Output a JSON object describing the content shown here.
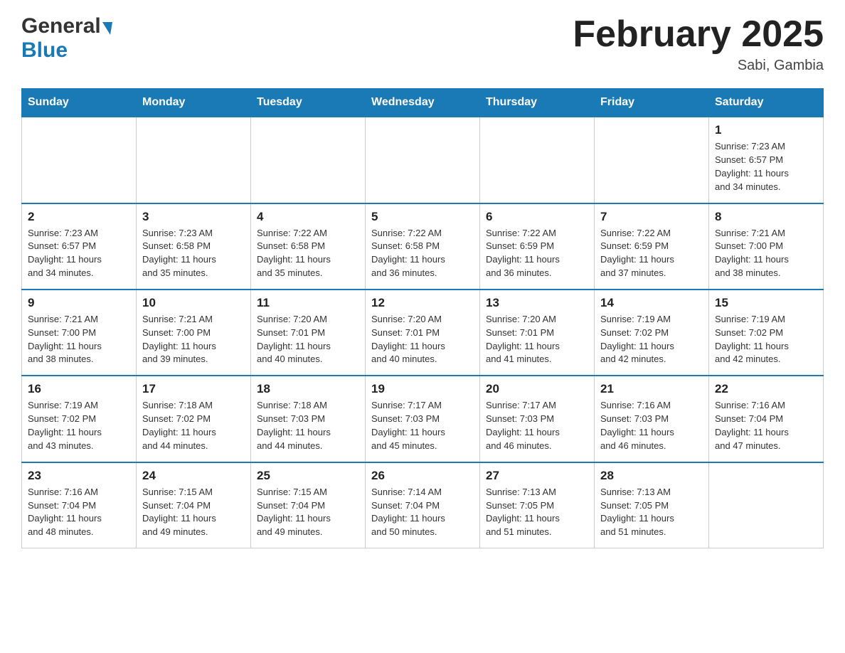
{
  "logo": {
    "general": "General",
    "blue": "Blue"
  },
  "title": {
    "month_year": "February 2025",
    "location": "Sabi, Gambia"
  },
  "days_of_week": [
    "Sunday",
    "Monday",
    "Tuesday",
    "Wednesday",
    "Thursday",
    "Friday",
    "Saturday"
  ],
  "weeks": [
    {
      "cells": [
        {
          "day": "",
          "info": ""
        },
        {
          "day": "",
          "info": ""
        },
        {
          "day": "",
          "info": ""
        },
        {
          "day": "",
          "info": ""
        },
        {
          "day": "",
          "info": ""
        },
        {
          "day": "",
          "info": ""
        },
        {
          "day": "1",
          "info": "Sunrise: 7:23 AM\nSunset: 6:57 PM\nDaylight: 11 hours\nand 34 minutes."
        }
      ]
    },
    {
      "cells": [
        {
          "day": "2",
          "info": "Sunrise: 7:23 AM\nSunset: 6:57 PM\nDaylight: 11 hours\nand 34 minutes."
        },
        {
          "day": "3",
          "info": "Sunrise: 7:23 AM\nSunset: 6:58 PM\nDaylight: 11 hours\nand 35 minutes."
        },
        {
          "day": "4",
          "info": "Sunrise: 7:22 AM\nSunset: 6:58 PM\nDaylight: 11 hours\nand 35 minutes."
        },
        {
          "day": "5",
          "info": "Sunrise: 7:22 AM\nSunset: 6:58 PM\nDaylight: 11 hours\nand 36 minutes."
        },
        {
          "day": "6",
          "info": "Sunrise: 7:22 AM\nSunset: 6:59 PM\nDaylight: 11 hours\nand 36 minutes."
        },
        {
          "day": "7",
          "info": "Sunrise: 7:22 AM\nSunset: 6:59 PM\nDaylight: 11 hours\nand 37 minutes."
        },
        {
          "day": "8",
          "info": "Sunrise: 7:21 AM\nSunset: 7:00 PM\nDaylight: 11 hours\nand 38 minutes."
        }
      ]
    },
    {
      "cells": [
        {
          "day": "9",
          "info": "Sunrise: 7:21 AM\nSunset: 7:00 PM\nDaylight: 11 hours\nand 38 minutes."
        },
        {
          "day": "10",
          "info": "Sunrise: 7:21 AM\nSunset: 7:00 PM\nDaylight: 11 hours\nand 39 minutes."
        },
        {
          "day": "11",
          "info": "Sunrise: 7:20 AM\nSunset: 7:01 PM\nDaylight: 11 hours\nand 40 minutes."
        },
        {
          "day": "12",
          "info": "Sunrise: 7:20 AM\nSunset: 7:01 PM\nDaylight: 11 hours\nand 40 minutes."
        },
        {
          "day": "13",
          "info": "Sunrise: 7:20 AM\nSunset: 7:01 PM\nDaylight: 11 hours\nand 41 minutes."
        },
        {
          "day": "14",
          "info": "Sunrise: 7:19 AM\nSunset: 7:02 PM\nDaylight: 11 hours\nand 42 minutes."
        },
        {
          "day": "15",
          "info": "Sunrise: 7:19 AM\nSunset: 7:02 PM\nDaylight: 11 hours\nand 42 minutes."
        }
      ]
    },
    {
      "cells": [
        {
          "day": "16",
          "info": "Sunrise: 7:19 AM\nSunset: 7:02 PM\nDaylight: 11 hours\nand 43 minutes."
        },
        {
          "day": "17",
          "info": "Sunrise: 7:18 AM\nSunset: 7:02 PM\nDaylight: 11 hours\nand 44 minutes."
        },
        {
          "day": "18",
          "info": "Sunrise: 7:18 AM\nSunset: 7:03 PM\nDaylight: 11 hours\nand 44 minutes."
        },
        {
          "day": "19",
          "info": "Sunrise: 7:17 AM\nSunset: 7:03 PM\nDaylight: 11 hours\nand 45 minutes."
        },
        {
          "day": "20",
          "info": "Sunrise: 7:17 AM\nSunset: 7:03 PM\nDaylight: 11 hours\nand 46 minutes."
        },
        {
          "day": "21",
          "info": "Sunrise: 7:16 AM\nSunset: 7:03 PM\nDaylight: 11 hours\nand 46 minutes."
        },
        {
          "day": "22",
          "info": "Sunrise: 7:16 AM\nSunset: 7:04 PM\nDaylight: 11 hours\nand 47 minutes."
        }
      ]
    },
    {
      "cells": [
        {
          "day": "23",
          "info": "Sunrise: 7:16 AM\nSunset: 7:04 PM\nDaylight: 11 hours\nand 48 minutes."
        },
        {
          "day": "24",
          "info": "Sunrise: 7:15 AM\nSunset: 7:04 PM\nDaylight: 11 hours\nand 49 minutes."
        },
        {
          "day": "25",
          "info": "Sunrise: 7:15 AM\nSunset: 7:04 PM\nDaylight: 11 hours\nand 49 minutes."
        },
        {
          "day": "26",
          "info": "Sunrise: 7:14 AM\nSunset: 7:04 PM\nDaylight: 11 hours\nand 50 minutes."
        },
        {
          "day": "27",
          "info": "Sunrise: 7:13 AM\nSunset: 7:05 PM\nDaylight: 11 hours\nand 51 minutes."
        },
        {
          "day": "28",
          "info": "Sunrise: 7:13 AM\nSunset: 7:05 PM\nDaylight: 11 hours\nand 51 minutes."
        },
        {
          "day": "",
          "info": ""
        }
      ]
    }
  ]
}
